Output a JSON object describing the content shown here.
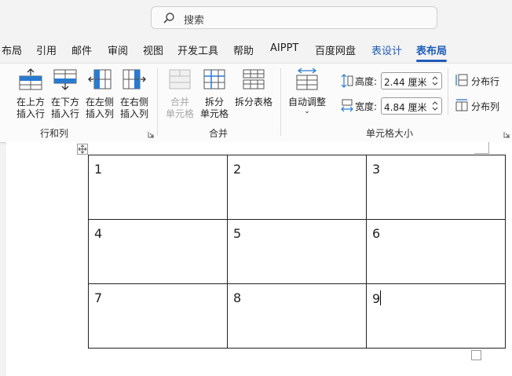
{
  "search": {
    "placeholder": "搜索"
  },
  "tabs": [
    {
      "label": "布局"
    },
    {
      "label": "引用"
    },
    {
      "label": "邮件"
    },
    {
      "label": "审阅"
    },
    {
      "label": "视图"
    },
    {
      "label": "开发工具"
    },
    {
      "label": "帮助"
    },
    {
      "label": "AIPPT"
    },
    {
      "label": "百度网盘"
    },
    {
      "label": "表设计"
    },
    {
      "label": "表布局"
    }
  ],
  "ribbon": {
    "rows_cols": {
      "group_label": "行和列",
      "insert_above": [
        "在上方",
        "插入行"
      ],
      "insert_below": [
        "在下方",
        "插入行"
      ],
      "insert_left": [
        "在左侧",
        "插入列"
      ],
      "insert_right": [
        "在右侧",
        "插入列"
      ]
    },
    "merge": {
      "group_label": "合并",
      "merge_cells": [
        "合并",
        "单元格"
      ],
      "split_cells": [
        "拆分",
        "单元格"
      ],
      "split_table": "拆分表格"
    },
    "cell_size": {
      "group_label": "单元格大小",
      "autofit": "自动调整",
      "height_label": "高度:",
      "height_value": "2.44 厘米",
      "width_label": "宽度:",
      "width_value": "4.84 厘米",
      "distribute_rows": "分布行",
      "distribute_cols": "分布列"
    }
  },
  "table": {
    "rows": [
      [
        "1",
        "2",
        "3"
      ],
      [
        "4",
        "5",
        "6"
      ],
      [
        "7",
        "8",
        "9"
      ]
    ]
  },
  "colors": {
    "accent": "#1e5bb8",
    "icon_blue": "#2a7bd0"
  }
}
